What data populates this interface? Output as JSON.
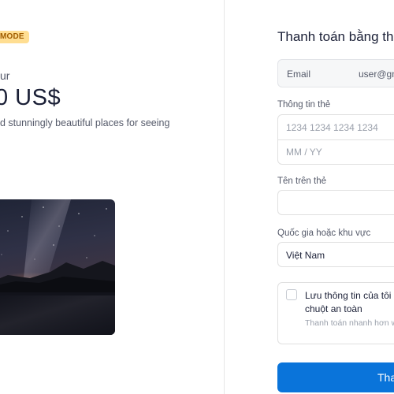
{
  "left": {
    "mode_badge": "MODE",
    "product_label": "ur",
    "price": "0 US$",
    "description": "d stunningly beautiful places for seeing"
  },
  "checkout": {
    "title": "Thanh toán bằng th",
    "email": {
      "label": "Email",
      "value": "user@gm"
    },
    "card": {
      "label": "Thông tin thẻ",
      "number_placeholder": "1234 1234 1234 1234",
      "expiry_placeholder": "MM / YY"
    },
    "name": {
      "label": "Tên trên thẻ",
      "value": ""
    },
    "country": {
      "label": "Quốc gia hoặc khu vực",
      "value": "Việt Nam"
    },
    "save_info": {
      "title": "Lưu thông tin của tôi chuột an toàn",
      "subtitle": "Thanh toán nhanh hơn web."
    },
    "pay_button": "Tha"
  },
  "colors": {
    "accent": "#0a74da",
    "badge_bg": "#ffde92",
    "badge_text": "#a05c00",
    "text_primary": "#1a1f36",
    "text_secondary": "#545969"
  },
  "icons": {
    "checkbox": "checkbox-empty-icon"
  }
}
